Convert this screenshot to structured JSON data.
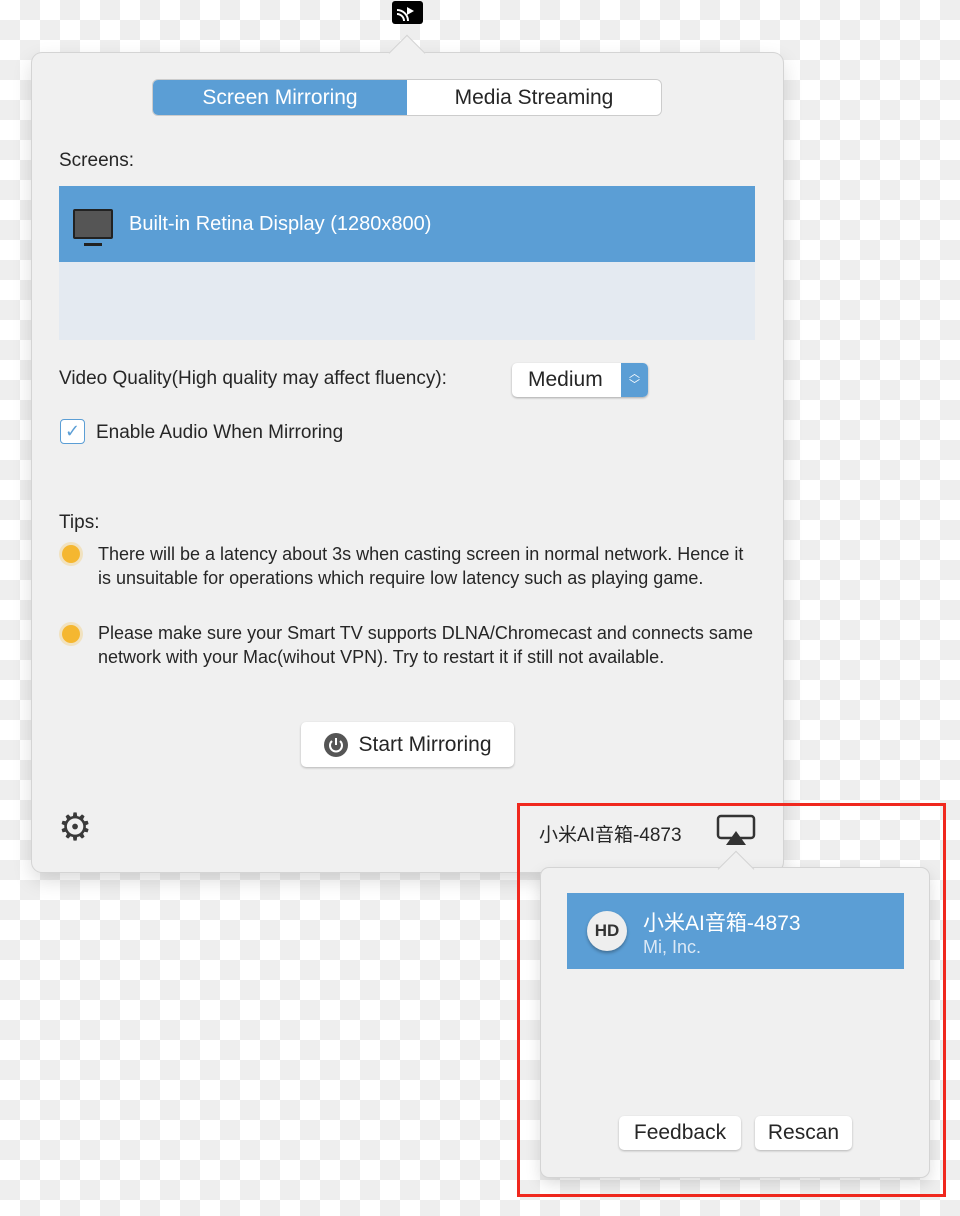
{
  "tabs": [
    {
      "label": "Screen Mirroring",
      "active": true
    },
    {
      "label": "Media Streaming",
      "active": false
    }
  ],
  "screens_label": "Screens:",
  "screens": [
    {
      "name": "Built-in Retina Display (1280x800)",
      "selected": true
    }
  ],
  "quality": {
    "label": "Video Quality(High quality may affect fluency):",
    "value": "Medium"
  },
  "audio": {
    "label": "Enable Audio When Mirroring",
    "checked": true
  },
  "tips": {
    "title": "Tips:",
    "items": [
      "There will be a latency about 3s when casting screen in normal network. Hence it is unsuitable for operations which require low latency such as playing game.",
      "Please make sure your Smart TV supports DLNA/Chromecast and connects same network with your Mac(wihout VPN). Try to restart it if still not available."
    ]
  },
  "start_button": "Start Mirroring",
  "current_device": "小米AI音箱-4873",
  "devices": [
    {
      "name": "小米AI音箱-4873",
      "vendor": "Mi, Inc.",
      "badge": "HD"
    }
  ],
  "feedback": "Feedback",
  "rescan": "Rescan",
  "colors": {
    "accent": "#5b9ed5",
    "highlight": "#f0281e"
  }
}
